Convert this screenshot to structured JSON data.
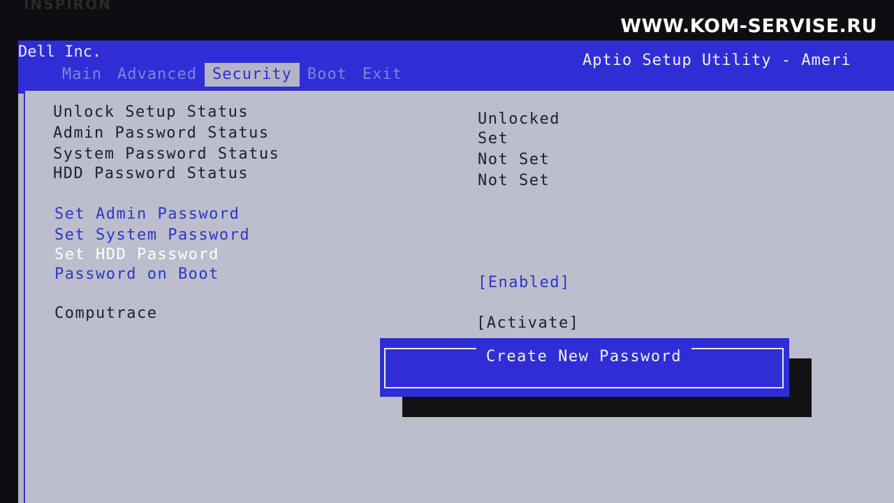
{
  "bezel_text": "INSPIRON",
  "watermark": "WWW.KOM-SERVISE.RU",
  "header": {
    "vendor": "Dell Inc.",
    "utility_title": "Aptio Setup Utility - Ameri",
    "tabs": [
      {
        "label": "Main",
        "active": false
      },
      {
        "label": "Advanced",
        "active": false
      },
      {
        "label": "Security",
        "active": true
      },
      {
        "label": "Boot",
        "active": false
      },
      {
        "label": "Exit",
        "active": false
      }
    ]
  },
  "status_items": [
    {
      "label": "Unlock Setup Status",
      "value": "Unlocked"
    },
    {
      "label": "Admin Password Status",
      "value": "Set"
    },
    {
      "label": "System Password Status",
      "value": "Not Set"
    },
    {
      "label": "HDD Password Status",
      "value": "Not Set"
    }
  ],
  "menu_items": [
    {
      "label": "Set Admin Password",
      "value": ""
    },
    {
      "label": "Set System Password",
      "value": ""
    },
    {
      "label": "Set HDD Password",
      "value": "",
      "selected": true
    },
    {
      "label": "Password on Boot",
      "value": "[Enabled]"
    }
  ],
  "computrace": {
    "label": "Computrace",
    "value": "[Activate]"
  },
  "dialog": {
    "title": "Create New Password",
    "input_value": ""
  },
  "colors": {
    "bios_blue": "#2f2ed6",
    "screen_gray": "#b4b6c6",
    "link_blue": "#2e36c8",
    "selected_white": "#ffffff"
  }
}
